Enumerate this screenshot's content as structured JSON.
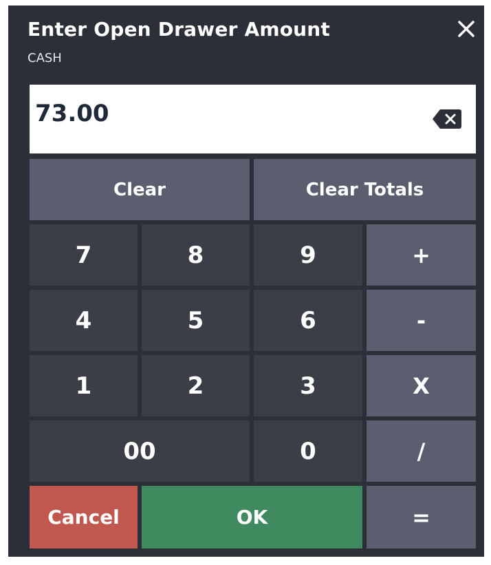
{
  "dialog": {
    "title": "Enter Open Drawer Amount",
    "subtitle": "CASH",
    "close_icon": "close-icon"
  },
  "display": {
    "value": "73.00",
    "backspace_icon": "backspace-icon"
  },
  "keys": {
    "clear": "Clear",
    "clear_totals": "Clear Totals",
    "seven": "7",
    "eight": "8",
    "nine": "9",
    "plus": "+",
    "four": "4",
    "five": "5",
    "six": "6",
    "minus": "-",
    "one": "1",
    "two": "2",
    "three": "3",
    "multiply": "X",
    "double_zero": "00",
    "zero": "0",
    "divide": "/",
    "cancel": "Cancel",
    "ok": "OK",
    "equals": "="
  },
  "colors": {
    "dialog_bg": "#2c2f37",
    "digit_key": "#3b3e47",
    "function_key": "#5a5e6e",
    "cancel_key": "#c0584f",
    "ok_key": "#3f8a5e"
  }
}
